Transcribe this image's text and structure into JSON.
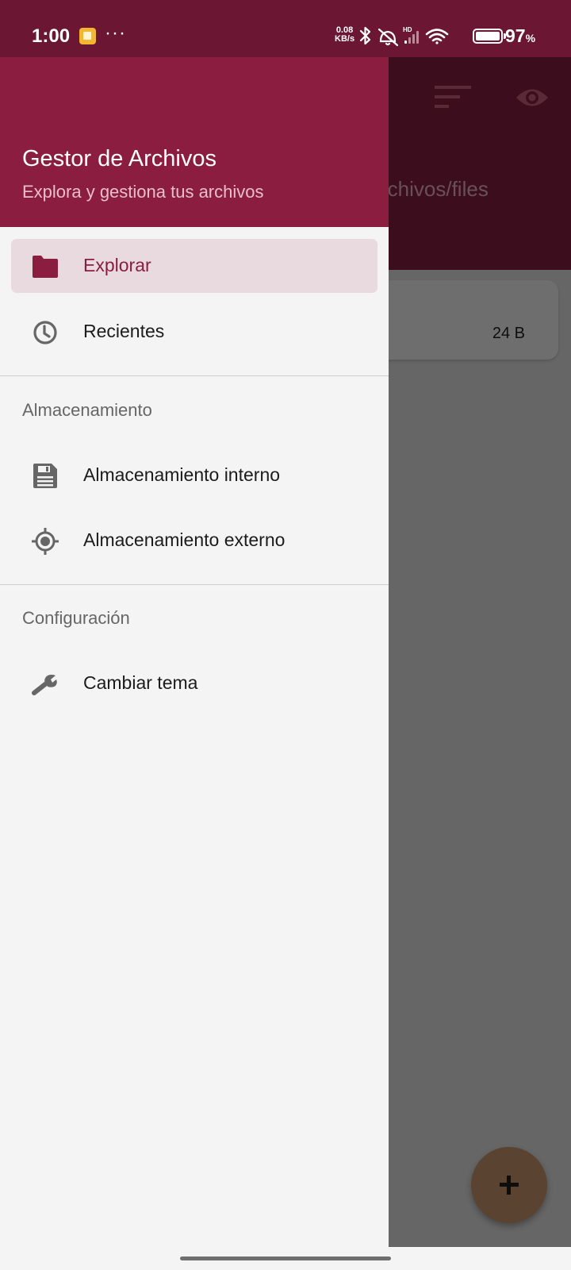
{
  "status_bar": {
    "time": "1:00",
    "dots": "···",
    "speed_value": "0.08",
    "speed_unit": "KB/s",
    "network_label": "HD",
    "battery_percent": "97",
    "battery_percent_sign": "%"
  },
  "background_app": {
    "path_text": "rchivos/files",
    "file_size": "24 B",
    "fab_label": "+"
  },
  "drawer": {
    "title": "Gestor de Archivos",
    "subtitle": "Explora y gestiona tus archivos",
    "items": [
      {
        "label": "Explorar",
        "icon": "folder-icon",
        "active": true
      },
      {
        "label": "Recientes",
        "icon": "clock-icon",
        "active": false
      }
    ],
    "sections": [
      {
        "label": "Almacenamiento",
        "items": [
          {
            "label": "Almacenamiento interno",
            "icon": "save-icon"
          },
          {
            "label": "Almacenamiento externo",
            "icon": "gps-icon"
          }
        ]
      },
      {
        "label": "Configuración",
        "items": [
          {
            "label": "Cambiar tema",
            "icon": "wrench-icon"
          }
        ]
      }
    ]
  },
  "colors": {
    "primary": "#8b1d40",
    "status_bar": "#6b1632",
    "drawer_background": "#f4f4f4",
    "active_item_background": "#e8dadf",
    "scrim": "#666666"
  }
}
